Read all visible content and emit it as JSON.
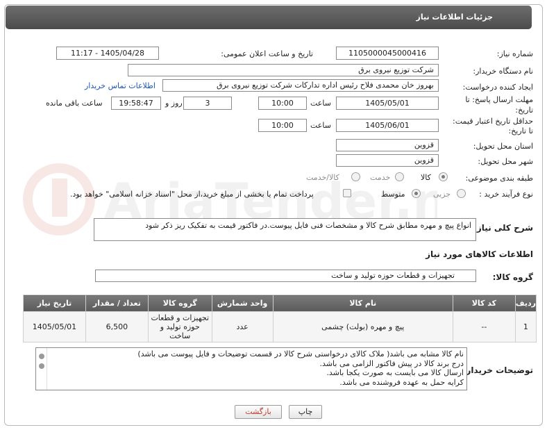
{
  "header": {
    "title": "جزئیات اطلاعات نیاز"
  },
  "fields": {
    "need_number": {
      "label": "شماره نیاز:",
      "value": "1105000045000416"
    },
    "announce_datetime": {
      "label": "تاریخ و ساعت اعلان عمومی:",
      "value": "1405/04/28 - 11:17"
    },
    "buyer_org": {
      "label": "نام دستگاه خریدار:",
      "value": "شرکت توزیع نیروی برق"
    },
    "requester": {
      "label": "ایجاد کننده درخواست:",
      "value": "بهروز خان محمدی فلاح رئیس اداره تدارکات شرکت توزیع نیروی برق",
      "link": "اطلاعات تماس خریدار"
    },
    "deadline": {
      "label_line1": "مهلت ارسال پاسخ: تا",
      "label_line2": "تاریخ:",
      "date": "1405/05/01",
      "time_label": "ساعت",
      "time": "10:00",
      "days": "3",
      "days_label": "روز و",
      "remaining": "19:58:47",
      "remaining_label": "ساعت باقی مانده"
    },
    "price_validity": {
      "label_line1": "حداقل تاریخ اعتبار قیمت:",
      "label_line2": "تا تاریخ:",
      "date": "1405/06/01",
      "time_label": "ساعت",
      "time": "10:00"
    },
    "delivery_province": {
      "label": "استان محل تحویل:",
      "value": "قزوین"
    },
    "delivery_city": {
      "label": "شهر محل تحویل:",
      "value": "قزوین"
    },
    "category": {
      "label": "طبقه بندی موضوعی:",
      "options": [
        "کالا",
        "خدمت",
        "کالا/خدمت"
      ],
      "selected": "کالا"
    },
    "purchase_process": {
      "label": "نوع فرآیند خرید :",
      "options": [
        "جزیی",
        "متوسط"
      ],
      "selected": "متوسط",
      "payment_note": "پرداخت تمام یا بخشی از مبلغ خرید،از محل \"اسناد خزانه اسلامی\" خواهد بود."
    }
  },
  "description": {
    "label": "شرح کلی نیاز:",
    "value": "انواع پیچ و مهره  مطابق شرح کالا و مشخصات فنی  فایل پیوست.در فاکتور قیمت  به تفکیک ریز ذکر شود"
  },
  "goods_section": {
    "title": "اطلاعات کالاهای مورد نیاز"
  },
  "goods_group": {
    "label": "گروه کالا:",
    "value": "تجهیزات و قطعات حوزه تولید و ساخت"
  },
  "items_table": {
    "headers": [
      "ردیف",
      "کد کالا",
      "نام کالا",
      "واحد شمارش",
      "گروه کالا",
      "تعداد / مقدار",
      "تاریخ نیاز"
    ],
    "rows": [
      {
        "row": "1",
        "code": "--",
        "name": "پیچ و مهره (بولت) چشمی",
        "unit": "عدد",
        "group": "تجهیزات و قطعات حوزه تولید و ساخت",
        "qty": "6,500",
        "date": "1405/05/01"
      }
    ]
  },
  "buyer_notes": {
    "label": "توضیحات خریدار:",
    "lines": [
      "نام کالا مشابه می باشد( ملاک کالای درخواستی شرح کالا در قسمت توضیحات و فایل پیوست می باشد)",
      "درج برند کالا در پیش فاکتور الزامی می باشد.",
      "ارسال کالا می بایست به صورت یکجا باشد.",
      "کرایه حمل به عهده فروشنده می باشد."
    ]
  },
  "buttons": {
    "print": "چاپ",
    "back": "بازگشت"
  },
  "colors": {
    "header_bg": "#5a5a5a",
    "link": "#1a55b8",
    "back_text": "#c0392b"
  }
}
